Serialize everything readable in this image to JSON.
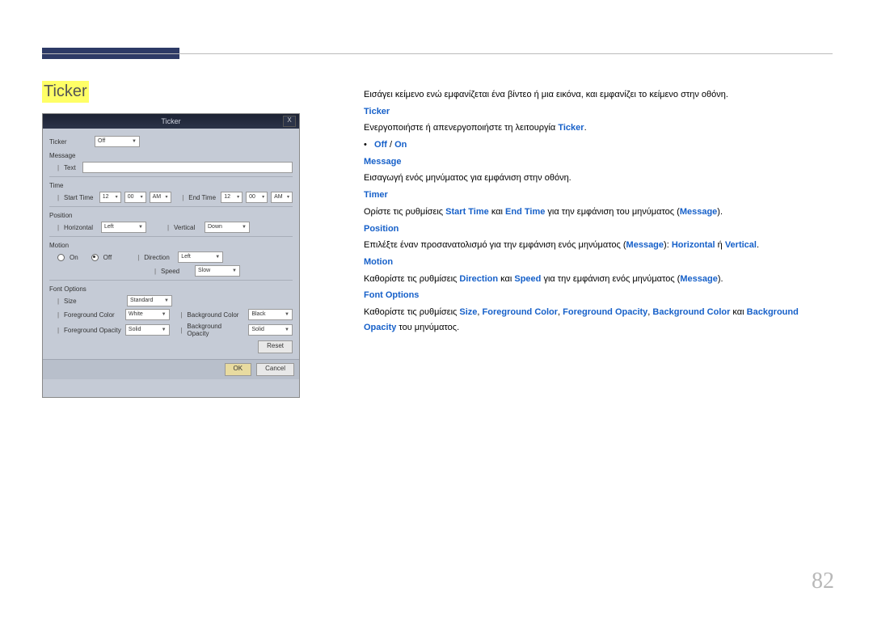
{
  "page_number": "82",
  "section_title": "Ticker",
  "intro": "Εισάγει κείμενο ενώ εμφανίζεται ένα βίντεο ή μια εικόνα, και εμφανίζει το κείμενο στην οθόνη.",
  "ticker": {
    "heading": "Ticker",
    "line_pre": "Ενεργοποιήστε ή απενεργοποιήστε τη λειτουργία ",
    "line_term": "Ticker",
    "line_post": ".",
    "off": "Off",
    "slash": " / ",
    "on": "On"
  },
  "message": {
    "heading": "Message",
    "text": "Εισαγωγή ενός μηνύματος για εμφάνιση στην οθόνη."
  },
  "timer": {
    "heading": "Timer",
    "pre": "Ορίστε τις ρυθμίσεις ",
    "t1": "Start Time",
    "mid1": " και ",
    "t2": "End Time",
    "mid2": " για την εμφάνιση του μηνύματος (",
    "t3": "Message",
    "post": ")."
  },
  "position": {
    "heading": "Position",
    "pre": "Επιλέξτε έναν προσανατολισμό για την εμφάνιση ενός μηνύματος (",
    "t1": "Message",
    "mid1": "): ",
    "t2": "Horizontal",
    "mid2": " ή ",
    "t3": "Vertical",
    "post": "."
  },
  "motion": {
    "heading": "Motion",
    "pre": "Καθορίστε τις ρυθμίσεις ",
    "t1": "Direction",
    "mid1": " και ",
    "t2": "Speed",
    "mid2": " για την εμφάνιση ενός μηνύματος (",
    "t3": "Message",
    "post": ")."
  },
  "font": {
    "heading": "Font Options",
    "pre": "Καθορίστε τις ρυθμίσεις ",
    "t1": "Size",
    "c1": ", ",
    "t2": "Foreground Color",
    "c2": ", ",
    "t3": "Foreground Opacity",
    "c3": ", ",
    "t4": "Background Color",
    "mid": " και ",
    "t5": "Background Opacity",
    "post": " του μηνύματος."
  },
  "dialog": {
    "title": "Ticker",
    "close": "X",
    "labels": {
      "ticker": "Ticker",
      "off": "Off",
      "message": "Message",
      "text": "Text",
      "time": "Time",
      "start_time": "Start Time",
      "end_time": "End Time",
      "position": "Position",
      "horizontal": "Horizontal",
      "vertical": "Vertical",
      "left": "Left",
      "down": "Down",
      "motion": "Motion",
      "on": "On",
      "off2": "Off",
      "direction": "Direction",
      "speed": "Speed",
      "slow": "Slow",
      "font_options": "Font Options",
      "size": "Size",
      "standard": "Standard",
      "fg_color": "Foreground Color",
      "white": "White",
      "bg_color": "Background Color",
      "black": "Black",
      "fg_opacity": "Foreground Opacity",
      "solid": "Solid",
      "bg_opacity": "Background Opacity",
      "reset": "Reset",
      "ok": "OK",
      "cancel": "Cancel",
      "h12": "12",
      "m00": "00",
      "am": "AM"
    }
  }
}
